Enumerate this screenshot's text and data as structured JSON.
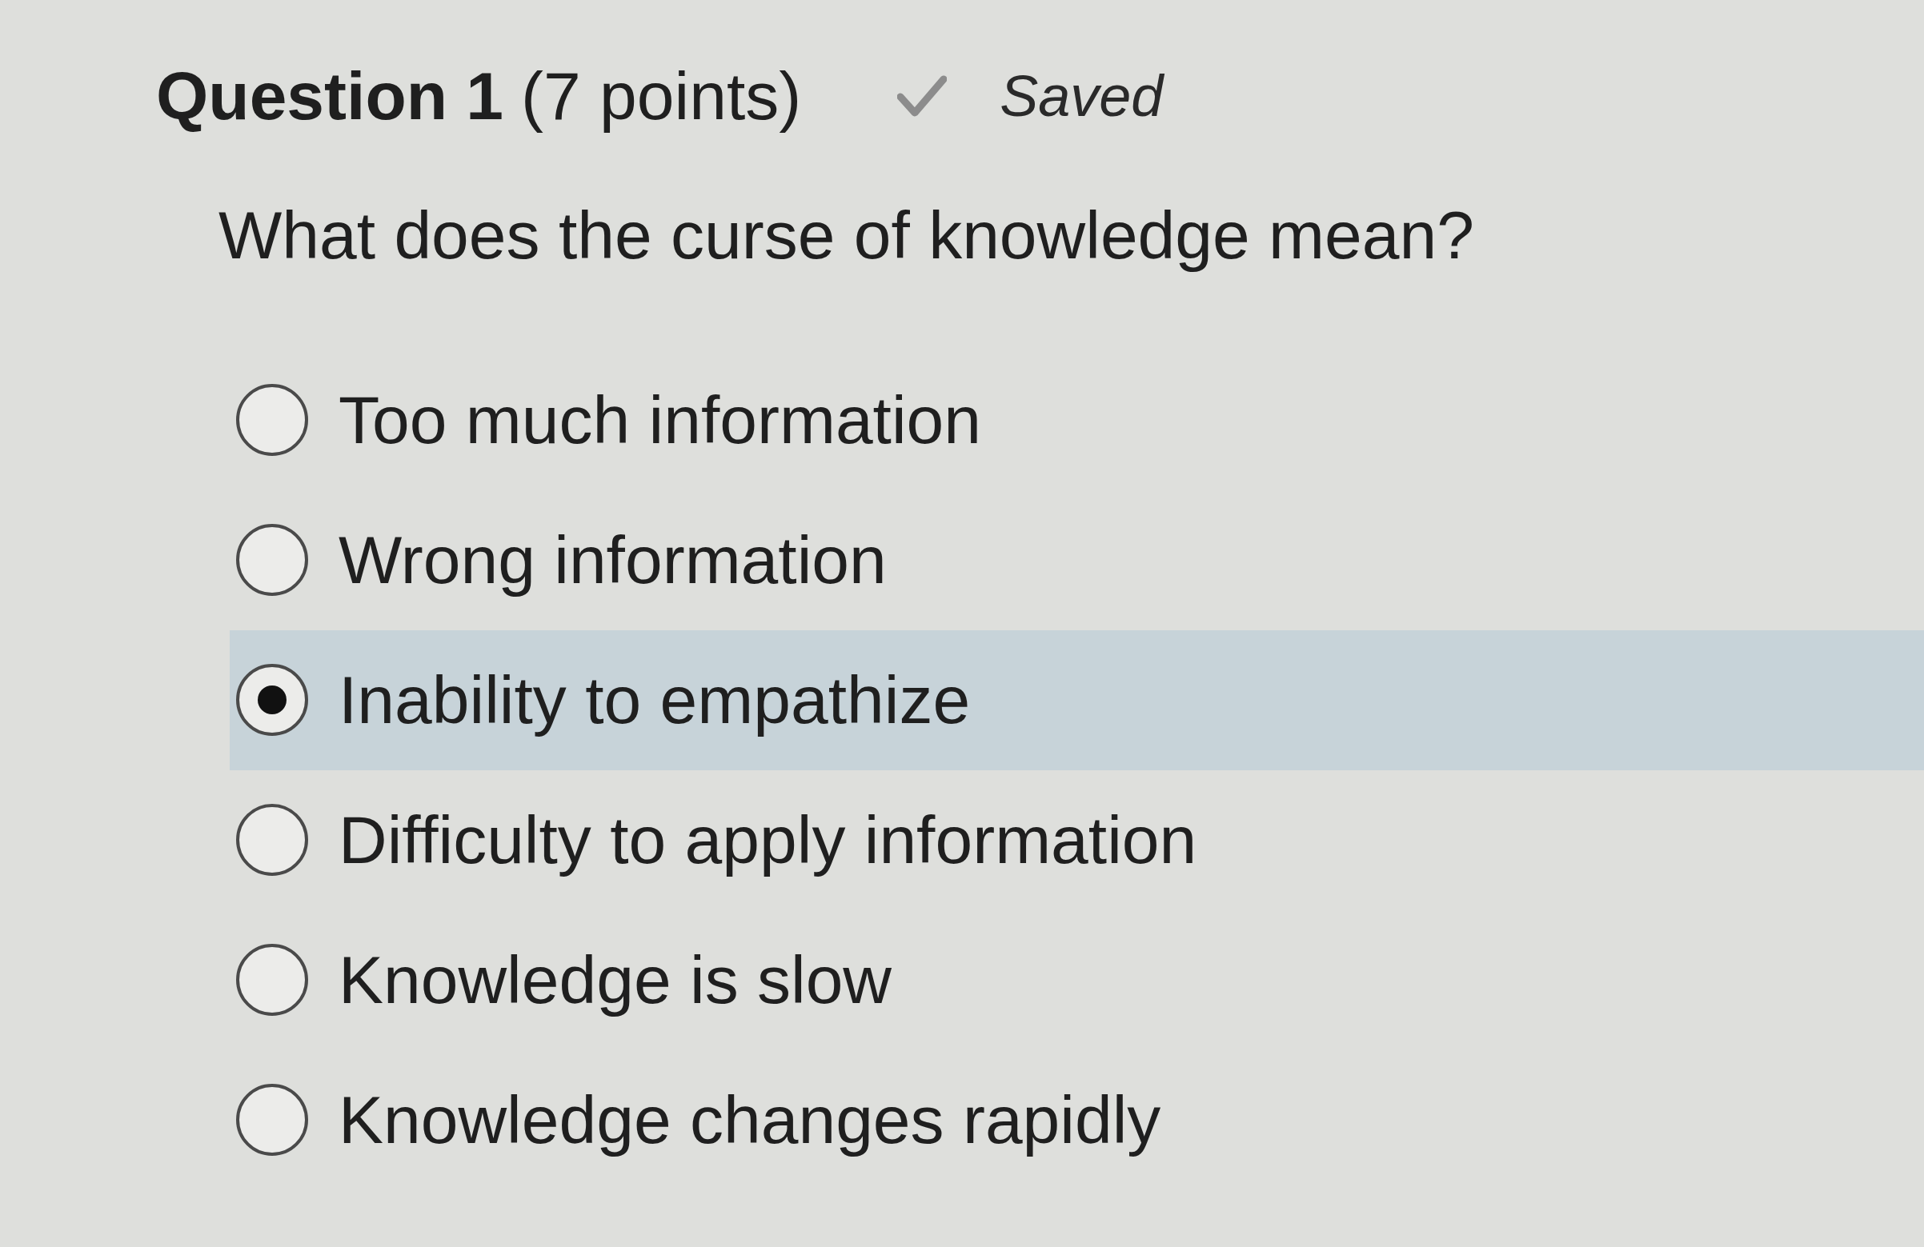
{
  "question": {
    "title": "Question 1",
    "points": "(7 points)",
    "status": "Saved"
  },
  "prompt": "What does the curse of knowledge mean?",
  "options": [
    {
      "label": "Too much information",
      "selected": false
    },
    {
      "label": "Wrong information",
      "selected": false
    },
    {
      "label": "Inability to empathize",
      "selected": true
    },
    {
      "label": "Difficulty to apply information",
      "selected": false
    },
    {
      "label": "Knowledge is slow",
      "selected": false
    },
    {
      "label": "Knowledge changes rapidly",
      "selected": false
    }
  ]
}
